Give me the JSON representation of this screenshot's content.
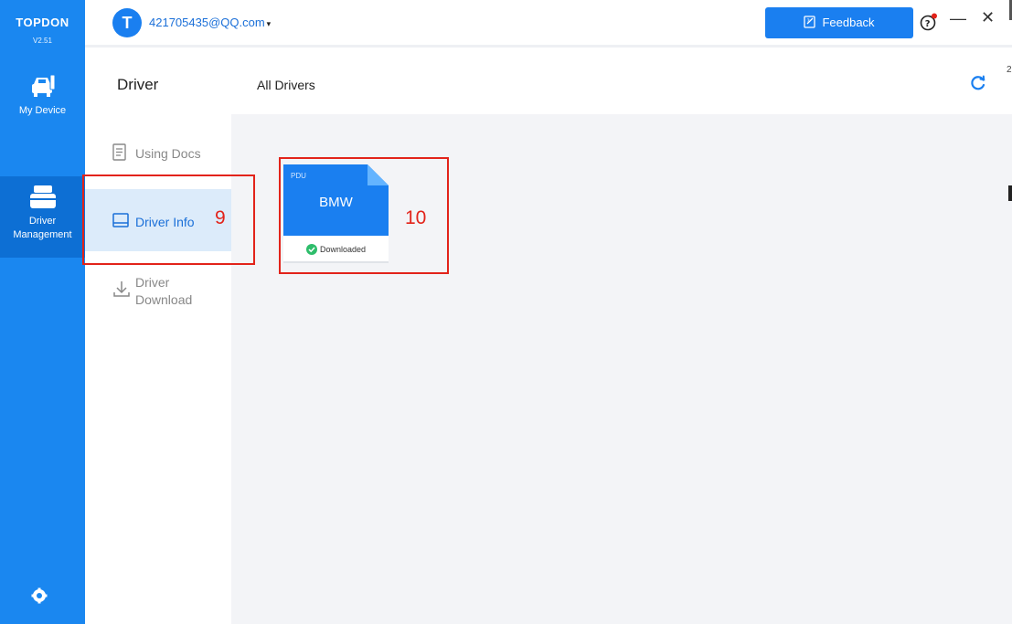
{
  "app": {
    "brand": "TOPDON",
    "version": "V2.51"
  },
  "rail": {
    "items": [
      {
        "label": "My Device"
      },
      {
        "label": "Driver Management"
      }
    ]
  },
  "topbar": {
    "avatar_letter": "T",
    "account": "421705435@QQ.com",
    "caret": "▾",
    "feedback_label": "Feedback",
    "minimize": "—",
    "close": "✕"
  },
  "subnav": {
    "title": "Driver",
    "items": [
      {
        "label": "Using Docs"
      },
      {
        "label": "Driver Info"
      },
      {
        "label_line1": "Driver",
        "label_line2": "Download"
      }
    ]
  },
  "content": {
    "title": "All Drivers",
    "cards": [
      {
        "type": "PDU",
        "name": "BMW",
        "status": "Downloaded"
      }
    ]
  },
  "annotations": {
    "box_a": "9",
    "box_b": "10"
  },
  "edge": {
    "char": "2"
  },
  "colors": {
    "primary": "#1a87f0",
    "accent": "#1a7ff0",
    "selected_bg": "#dcebfa",
    "annotation": "#e2231a",
    "success": "#2ebd6b"
  }
}
